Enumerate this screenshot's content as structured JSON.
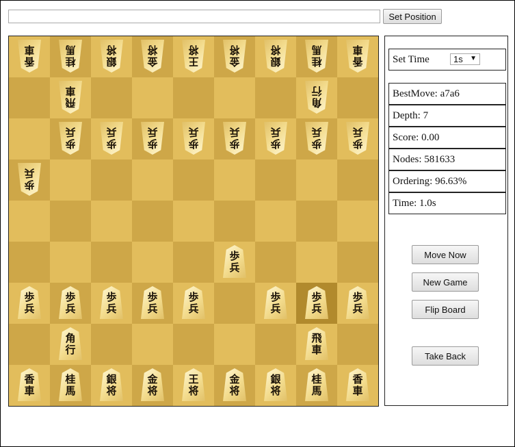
{
  "position_input": {
    "value": "",
    "placeholder": ""
  },
  "set_position_label": "Set Position",
  "board": {
    "highlight": [
      [
        6,
        7
      ]
    ],
    "pieces": [
      {
        "row": 0,
        "col": 0,
        "chars": [
          "香",
          "車"
        ],
        "side": "gote"
      },
      {
        "row": 0,
        "col": 1,
        "chars": [
          "桂",
          "馬"
        ],
        "side": "gote"
      },
      {
        "row": 0,
        "col": 2,
        "chars": [
          "銀",
          "将"
        ],
        "side": "gote"
      },
      {
        "row": 0,
        "col": 3,
        "chars": [
          "金",
          "将"
        ],
        "side": "gote"
      },
      {
        "row": 0,
        "col": 4,
        "chars": [
          "王",
          "将"
        ],
        "side": "gote"
      },
      {
        "row": 0,
        "col": 5,
        "chars": [
          "金",
          "将"
        ],
        "side": "gote"
      },
      {
        "row": 0,
        "col": 6,
        "chars": [
          "銀",
          "将"
        ],
        "side": "gote"
      },
      {
        "row": 0,
        "col": 7,
        "chars": [
          "桂",
          "馬"
        ],
        "side": "gote"
      },
      {
        "row": 0,
        "col": 8,
        "chars": [
          "香",
          "車"
        ],
        "side": "gote"
      },
      {
        "row": 1,
        "col": 1,
        "chars": [
          "飛",
          "車"
        ],
        "side": "gote"
      },
      {
        "row": 1,
        "col": 7,
        "chars": [
          "角",
          "行"
        ],
        "side": "gote"
      },
      {
        "row": 2,
        "col": 1,
        "chars": [
          "歩",
          "兵"
        ],
        "side": "gote"
      },
      {
        "row": 2,
        "col": 2,
        "chars": [
          "歩",
          "兵"
        ],
        "side": "gote"
      },
      {
        "row": 2,
        "col": 3,
        "chars": [
          "歩",
          "兵"
        ],
        "side": "gote"
      },
      {
        "row": 2,
        "col": 4,
        "chars": [
          "歩",
          "兵"
        ],
        "side": "gote"
      },
      {
        "row": 2,
        "col": 5,
        "chars": [
          "歩",
          "兵"
        ],
        "side": "gote"
      },
      {
        "row": 2,
        "col": 6,
        "chars": [
          "歩",
          "兵"
        ],
        "side": "gote"
      },
      {
        "row": 2,
        "col": 7,
        "chars": [
          "歩",
          "兵"
        ],
        "side": "gote"
      },
      {
        "row": 2,
        "col": 8,
        "chars": [
          "歩",
          "兵"
        ],
        "side": "gote"
      },
      {
        "row": 3,
        "col": 0,
        "chars": [
          "歩",
          "兵"
        ],
        "side": "gote"
      },
      {
        "row": 5,
        "col": 5,
        "chars": [
          "歩",
          "兵"
        ],
        "side": "sente"
      },
      {
        "row": 6,
        "col": 0,
        "chars": [
          "歩",
          "兵"
        ],
        "side": "sente"
      },
      {
        "row": 6,
        "col": 1,
        "chars": [
          "歩",
          "兵"
        ],
        "side": "sente"
      },
      {
        "row": 6,
        "col": 2,
        "chars": [
          "歩",
          "兵"
        ],
        "side": "sente"
      },
      {
        "row": 6,
        "col": 3,
        "chars": [
          "歩",
          "兵"
        ],
        "side": "sente"
      },
      {
        "row": 6,
        "col": 4,
        "chars": [
          "歩",
          "兵"
        ],
        "side": "sente"
      },
      {
        "row": 6,
        "col": 6,
        "chars": [
          "歩",
          "兵"
        ],
        "side": "sente"
      },
      {
        "row": 6,
        "col": 7,
        "chars": [
          "歩",
          "兵"
        ],
        "side": "sente"
      },
      {
        "row": 6,
        "col": 8,
        "chars": [
          "歩",
          "兵"
        ],
        "side": "sente"
      },
      {
        "row": 7,
        "col": 1,
        "chars": [
          "角",
          "行"
        ],
        "side": "sente"
      },
      {
        "row": 7,
        "col": 7,
        "chars": [
          "飛",
          "車"
        ],
        "side": "sente"
      },
      {
        "row": 8,
        "col": 0,
        "chars": [
          "香",
          "車"
        ],
        "side": "sente"
      },
      {
        "row": 8,
        "col": 1,
        "chars": [
          "桂",
          "馬"
        ],
        "side": "sente"
      },
      {
        "row": 8,
        "col": 2,
        "chars": [
          "銀",
          "将"
        ],
        "side": "sente"
      },
      {
        "row": 8,
        "col": 3,
        "chars": [
          "金",
          "将"
        ],
        "side": "sente"
      },
      {
        "row": 8,
        "col": 4,
        "chars": [
          "王",
          "将"
        ],
        "side": "sente"
      },
      {
        "row": 8,
        "col": 5,
        "chars": [
          "金",
          "将"
        ],
        "side": "sente"
      },
      {
        "row": 8,
        "col": 6,
        "chars": [
          "銀",
          "将"
        ],
        "side": "sente"
      },
      {
        "row": 8,
        "col": 7,
        "chars": [
          "桂",
          "馬"
        ],
        "side": "sente"
      },
      {
        "row": 8,
        "col": 8,
        "chars": [
          "香",
          "車"
        ],
        "side": "sente"
      }
    ]
  },
  "panel": {
    "set_time_label": "Set Time",
    "time_value": "1s",
    "best_move": "BestMove: a7a6",
    "depth": "Depth: 7",
    "score": "Score: 0.00",
    "nodes": "Nodes: 581633",
    "ordering": "Ordering: 96.63%",
    "time": "Time: 1.0s"
  },
  "buttons": {
    "move_now": "Move Now",
    "new_game": "New Game",
    "flip_board": "Flip Board",
    "take_back": "Take Back"
  }
}
